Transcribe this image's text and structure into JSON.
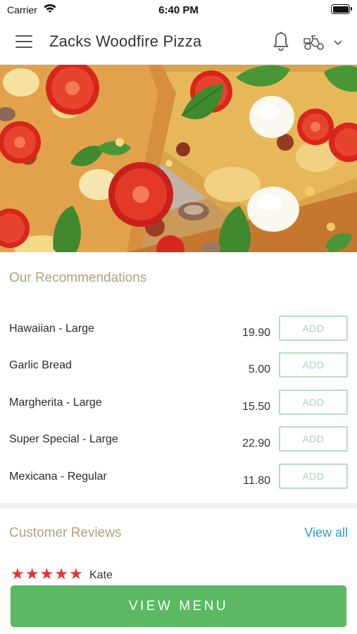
{
  "status_bar": {
    "carrier": "Carrier",
    "time": "6:40 PM",
    "wifi_icon": "wifi-icon",
    "battery_icon": "battery-icon"
  },
  "header": {
    "title": "Zacks Woodfire Pizza",
    "menu_icon": "hamburger-menu-icon",
    "bell_icon": "bell-icon",
    "delivery_icon": "scooter-icon",
    "dropdown_icon": "chevron-down-icon"
  },
  "hero": {
    "image": "pizza-photo"
  },
  "recommendations": {
    "title": "Our Recommendations",
    "items": [
      {
        "name": "Hawaiian - Large",
        "price": "19.90",
        "add_label": "ADD"
      },
      {
        "name": "Garlic Bread",
        "price": "5.00",
        "add_label": "ADD"
      },
      {
        "name": "Margherita - Large",
        "price": "15.50",
        "add_label": "ADD"
      },
      {
        "name": "Super Special - Large",
        "price": "22.90",
        "add_label": "ADD"
      },
      {
        "name": "Mexicana - Regular",
        "price": "11.80",
        "add_label": "ADD"
      }
    ]
  },
  "reviews": {
    "title": "Customer Reviews",
    "view_all_label": "View all",
    "first_review": {
      "reviewer": "Kate",
      "rating": 5
    }
  },
  "footer": {
    "view_menu_label": "VIEW MENU"
  },
  "colors": {
    "accent_green": "#5bb863",
    "add_border": "#b8ddc3",
    "section_title": "#b3a07f",
    "link_blue": "#2f9fbf",
    "star_red": "#e3342f"
  }
}
